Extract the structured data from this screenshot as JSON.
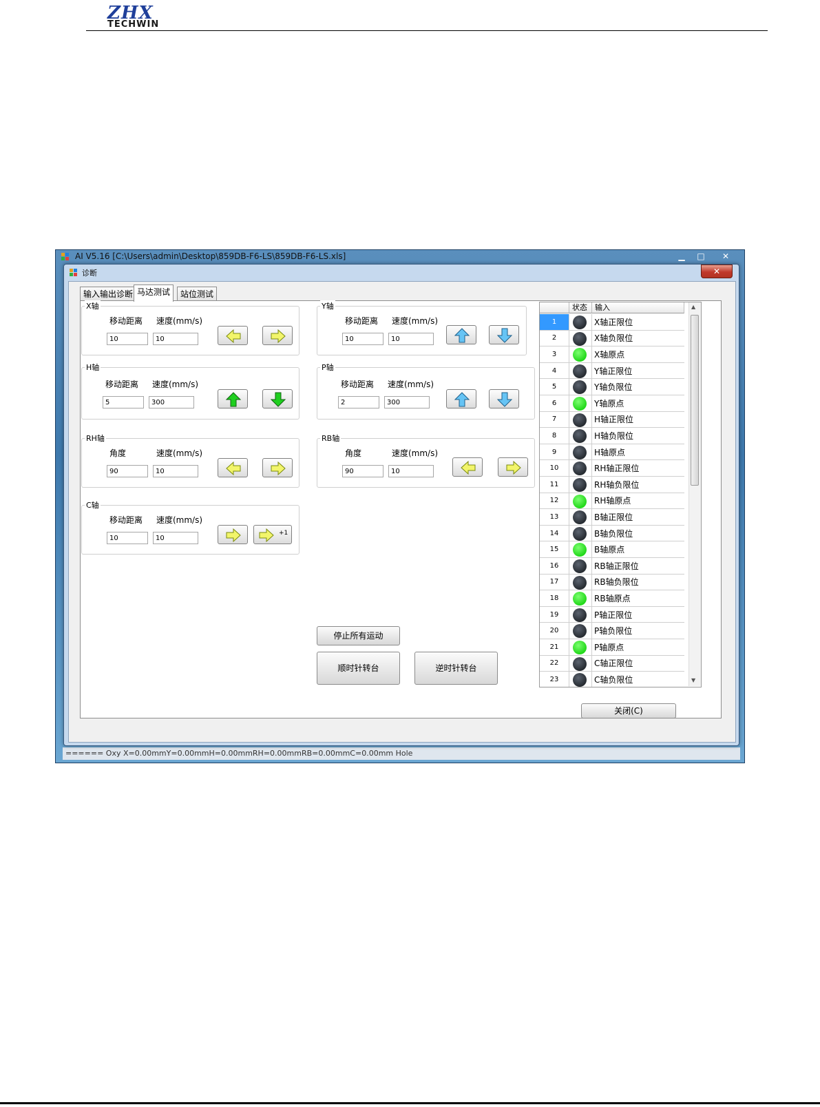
{
  "header": {
    "logo_mark": "ZHX",
    "logo_word": "TECHWIN"
  },
  "app_window": {
    "title": "AI V5.16 [C:\\Users\\admin\\Desktop\\859DB-F6-LS\\859DB-F6-LS.xls]",
    "minimize": "▁",
    "maximize": "□",
    "close": "✕",
    "status_bar": "======  Oxy  X=0.00mmY=0.00mmH=0.00mmRH=0.00mmRB=0.00mmC=0.00mm  Hole"
  },
  "dialog": {
    "title": "诊断",
    "close": "✕",
    "tabs": [
      "输入输出诊断",
      "马达测试",
      "站位测试"
    ],
    "active_tab": "马达测试",
    "close_button": "关闭(C)"
  },
  "axes": {
    "x": {
      "title": "X轴",
      "label1": "移动距离",
      "label2": "速度(mm/s)",
      "value1": "10",
      "value2": "10"
    },
    "h": {
      "title": "H轴",
      "label1": "移动距离",
      "label2": "速度(mm/s)",
      "value1": "5",
      "value2": "300"
    },
    "rh": {
      "title": "RH轴",
      "label1": "角度",
      "label2": "速度(mm/s)",
      "value1": "90",
      "value2": "10"
    },
    "c": {
      "title": "C轴",
      "label1": "移动距离",
      "label2": "速度(mm/s)",
      "value1": "10",
      "value2": "10",
      "plus1": "+1"
    },
    "y": {
      "title": "Y轴",
      "label1": "移动距离",
      "label2": "速度(mm/s)",
      "value1": "10",
      "value2": "10"
    },
    "p": {
      "title": "P轴",
      "label1": "移动距离",
      "label2": "速度(mm/s)",
      "value1": "2",
      "value2": "300"
    },
    "rb": {
      "title": "RB轴",
      "label1": "角度",
      "label2": "速度(mm/s)",
      "value1": "90",
      "value2": "10"
    }
  },
  "commands": {
    "stop_all": "停止所有运动",
    "clockwise": "顺时针转台",
    "counterclockwise": "逆时针转台"
  },
  "io_grid": {
    "headers": [
      "",
      "状态",
      "输入"
    ],
    "selected_row": "1",
    "rows": [
      {
        "num": "1",
        "on": false,
        "name": "X轴正限位"
      },
      {
        "num": "2",
        "on": false,
        "name": "X轴负限位"
      },
      {
        "num": "3",
        "on": true,
        "name": "X轴原点"
      },
      {
        "num": "4",
        "on": false,
        "name": "Y轴正限位"
      },
      {
        "num": "5",
        "on": false,
        "name": "Y轴负限位"
      },
      {
        "num": "6",
        "on": true,
        "name": "Y轴原点"
      },
      {
        "num": "7",
        "on": false,
        "name": "H轴正限位"
      },
      {
        "num": "8",
        "on": false,
        "name": "H轴负限位"
      },
      {
        "num": "9",
        "on": false,
        "name": "H轴原点"
      },
      {
        "num": "10",
        "on": false,
        "name": "RH轴正限位"
      },
      {
        "num": "11",
        "on": false,
        "name": "RH轴负限位"
      },
      {
        "num": "12",
        "on": true,
        "name": "RH轴原点"
      },
      {
        "num": "13",
        "on": false,
        "name": "B轴正限位"
      },
      {
        "num": "14",
        "on": false,
        "name": "B轴负限位"
      },
      {
        "num": "15",
        "on": true,
        "name": "B轴原点"
      },
      {
        "num": "16",
        "on": false,
        "name": "RB轴正限位"
      },
      {
        "num": "17",
        "on": false,
        "name": "RB轴负限位"
      },
      {
        "num": "18",
        "on": true,
        "name": "RB轴原点"
      },
      {
        "num": "19",
        "on": false,
        "name": "P轴正限位"
      },
      {
        "num": "20",
        "on": false,
        "name": "P轴负限位"
      },
      {
        "num": "21",
        "on": true,
        "name": "P轴原点"
      },
      {
        "num": "22",
        "on": false,
        "name": "C轴正限位"
      },
      {
        "num": "23",
        "on": false,
        "name": "C轴负限位"
      }
    ]
  },
  "colors": {
    "arrow_yellow": "#f2f56a",
    "arrow_green": "#1fcf1f",
    "arrow_blue": "#66c4f5",
    "led_on": "#22d81a",
    "led_off": "#2a2f35",
    "selection": "#3399ff"
  }
}
